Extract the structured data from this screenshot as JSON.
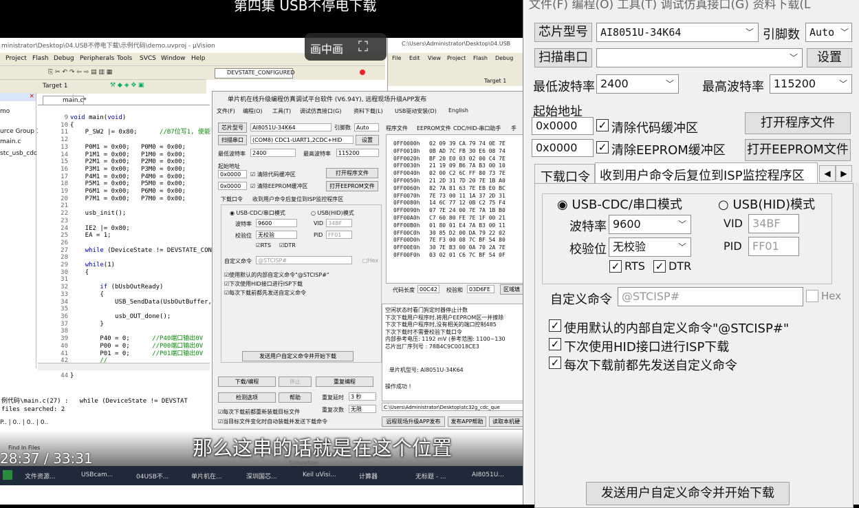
{
  "video": {
    "episode_title": "第四集 USB不停电下载",
    "pip_label": "画中画",
    "timecode": "28:37 / 33:31",
    "subtitle": "那么这串的话就是在这个位置"
  },
  "uvision": {
    "title_path": "ministrator\\Desktop\\04.USB不停电下载\\示例代码\\demo.uvproj - µVision",
    "menu": [
      "Project",
      "Flash",
      "Debug",
      "Peripherals",
      "Tools",
      "SVCS",
      "Window",
      "Help"
    ],
    "target": "Target 1",
    "toolbar_combo": "DEVSTATE_CONFIGURED",
    "tab": "main.c*",
    "project_tree": [
      "mo",
      "urce Group 1",
      "main.c",
      "stc_usb_cdc"
    ],
    "line_numbers": "9\n10\n11\n12\n13\n14\n15\n16\n17\n18\n19\n20\n21\n22\n23\n24\n25\n26\n27\n28\n29\n30\n31\n32\n33\n34\n35\n36\n37\n38\n39\n40\n41\n42\n43\n44",
    "find_line": "例代码\\main.c(27) :   while (DeviceState != DEVSTAT",
    "find_summary": "files searched: 2",
    "find_tab": "Find In Files"
  },
  "isp_small": {
    "title": "单片机在线升级编程仿真调试平台软件 (V6.94Y), 远程现场升级APP发布",
    "menu": [
      "文件(F)",
      "编程(O)",
      "工具(T)",
      "调试仿真接口(G)",
      "资料下载(L)",
      "USB驱动安装(D)",
      "English"
    ],
    "chip_label": "芯片型号",
    "chip_value": "AI8051U-34K64",
    "pins_label": "引脚数",
    "pins_value": "Auto",
    "scan_label": "扫描串口",
    "port_value": "(COM8) CDC1-UART1,2CDC+HID",
    "settings": "设置",
    "min_baud_label": "最低波特率",
    "min_baud": "2400",
    "max_baud_label": "最高波特率",
    "max_baud": "115200",
    "start_addr": "起始地址",
    "addr1": "0x0000",
    "addr2": "0x0000",
    "clear_code": "清除代码缓冲区",
    "clear_eeprom": "清除EEPROM缓冲区",
    "open_prog": "打开程序文件",
    "open_eeprom": "打开EEPROM文件",
    "tab_download": "下载口令",
    "tab_recv": "收到用户命令后复位到ISP监控程序区",
    "usb_cdc": "USB-CDC/串口模式",
    "usb_hid": "USB(HID)模式",
    "baud_label": "波特率",
    "baud": "9600",
    "parity_label": "校验位",
    "parity": "无校验",
    "vid": "VID",
    "vid_val": "34BF",
    "pid": "PID",
    "pid_val": "FF01",
    "rts": "RTS",
    "dtr": "DTR",
    "custom_cmd": "自定义命令",
    "custom_val": "@STCISP#",
    "hex": "Hex",
    "opt1": "使用默认的内部自定义命令\"@STCISP#\"",
    "opt2": "下次使用HID接口进行ISP下载",
    "opt3": "每次下载前都先发送自定义命令",
    "send_btn": "发送用户自定义命令并开始下载",
    "btn_download": "下载/编程",
    "btn_stop": "停止",
    "btn_reprog": "重复编程",
    "btn_check": "检测选项",
    "btn_help": "帮助",
    "delay_label": "重复延时",
    "delay_val": "3 秒",
    "repeat_label": "重复次数",
    "repeat_val": "无限",
    "chk_reload": "每次下载前都重新装载目标文件",
    "chk_auto": "当目标文件变化时自动装载并发送下载命令",
    "right_tabs": [
      "程序文件",
      "EEPROM文件",
      "CDC/HID-串口助手",
      "手"
    ],
    "hex_addr": "0FF0000h\n0FF0010h\n0FF0020h\n0FF0030h\n0FF0040h\n0FF0050h\n0FF0060h\n0FF0070h\n0FF0080h\n0FF0090h\n0FF00A0h\n0FF00B0h\n0FF00C0h\n0FF00D0h\n0FF00E0h\n0FF00F0h",
    "hex_data": "02 09 39 CA 79 74 0E 7E\n0B AD 7C FB 30 E6 08 74\nBF 20 E0 03 02 00 C4 7E\n21 19 09 B6 7A B3 00 10\n02 00 C2 6C FF 80 73 7E\n21 2D 31 7D 20 7E 1B A0\n82 7A 81 63 7E EB E0 BC\n7E 73 00 11 1A 37 2D 31\n14 6C 77 12 0B C2 75 F4\n07 7E 24 00 7E 7A 1B B0\nC7 60 80 FE 7E 1F 00 21\n01 80 01 E4 7A B3 00 11\n30 85 D2 00 DA 79 22 02\n7E F3 00 08 7C BF 54 80\n30 7E B3 00 0A 70 2A 7E\n03 02 01 C6 7C BF 54 0F",
    "code_len_label": "代码长度",
    "code_len": "00C42",
    "checksum_label": "校验和",
    "checksum": "03D6FE",
    "region_fill": "区域填",
    "log": "空闲状态时看门狗定时器停止计数\n下次下载用户程序时,将用户EEPROM区一并擦除\n下次下载用户程序时,没有相关的端口控制485\n下次下载时不需要校验下载口令\n内部参考电压: 1192 mV (参考范围: 1100~130\n芯片出厂序列号 : 78B4C9C0018CE3",
    "log_chip": "单片机型号: AI8051U-34K64",
    "log_ok": "操作成功 !",
    "path": "C:\\Users\\Administrator\\Desktop\\stc32g_cdc_que",
    "bottom_btns": [
      "远程现场升级APP发布",
      "发布APP帮助",
      "读取本机硬"
    ]
  },
  "explorer_win": {
    "title": "C:\\Users\\Administrator\\Desktop\\04.USB",
    "menu": [
      "File",
      "Edit",
      "View",
      "Project",
      "Flash",
      "Debug"
    ],
    "target": "Target 1"
  },
  "right_panel": {
    "top_menu": "文件(F)   编程(O)   工具(T)   调试仿真接口(G)   资料下载(L",
    "chip_btn": "芯片型号",
    "chip_value": "AI8051U-34K64",
    "pins_label": "引脚数",
    "pins_value": "Auto",
    "scan_btn": "扫描串口",
    "port_value": "",
    "settings_btn": "设置",
    "min_baud_label": "最低波特率",
    "min_baud": "2400",
    "max_baud_label": "最高波特率",
    "max_baud": "115200",
    "start_addr_label": "起始地址",
    "addr1": "0x0000",
    "addr2": "0x0000",
    "clear_code": "清除代码缓冲区",
    "clear_eeprom": "清除EEPROM缓冲区",
    "open_prog": "打开程序文件",
    "open_eeprom": "打开EEPROM文件",
    "tab_download": "下载口令",
    "tab_recv": "收到用户命令后复位到ISP监控程序区",
    "usb_cdc": "USB-CDC/串口模式",
    "usb_hid": "USB(HID)模式",
    "baud_label": "波特率",
    "baud": "9600",
    "parity_label": "校验位",
    "parity": "无校验",
    "vid_label": "VID",
    "vid": "34BF",
    "pid_label": "PID",
    "pid": "FF01",
    "rts": "RTS",
    "dtr": "DTR",
    "custom_label": "自定义命令",
    "custom_value": "@STCISP#",
    "hex_label": "Hex",
    "opt1": "使用默认的内部自定义命令\"@STCISP#\"",
    "opt2": "下次使用HID接口进行ISP下载",
    "opt3": "每次下载前都先发送自定义命令",
    "send_btn": "发送用户自定义命令并开始下载"
  },
  "taskbar": [
    "文件资源...",
    "USBcam...",
    "04USB不...",
    "单片机在...",
    "深圳国芯...",
    "Keil uVisi...",
    "计算器",
    "无标题 - ...",
    "AI8051U..."
  ],
  "taskbar_extra": "Simulation"
}
